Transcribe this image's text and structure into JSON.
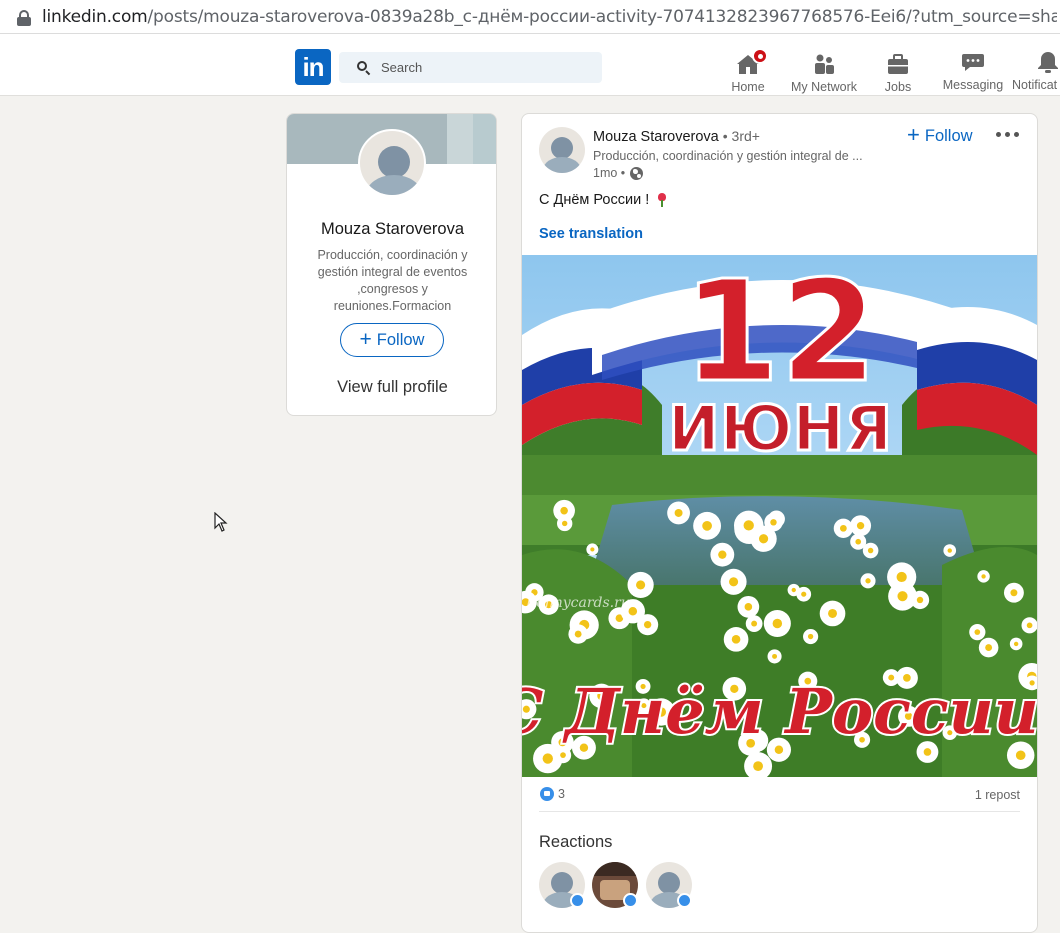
{
  "browser": {
    "url_domain": "linkedin.com",
    "url_path": "/posts/mouza-staroverova-0839a28b_с-днём-россии-activity-7074132823967768576-Eei6/?utm_source=share&utm_m"
  },
  "nav": {
    "logo": "in",
    "search_placeholder": "Search",
    "items": [
      {
        "label": "Home",
        "icon": "home-icon"
      },
      {
        "label": "My Network",
        "icon": "network-icon"
      },
      {
        "label": "Jobs",
        "icon": "briefcase-icon"
      },
      {
        "label": "Messaging",
        "icon": "chat-icon"
      },
      {
        "label": "Notificat",
        "icon": "bell-icon"
      }
    ]
  },
  "profile_card": {
    "name": "Mouza Staroverova",
    "headline": "Producción, coordinación y gestión integral de eventos ,congresos y reuniones.Formacion",
    "follow_label": "Follow",
    "view_profile_label": "View full profile"
  },
  "post": {
    "author": "Mouza Staroverova",
    "degree": "• 3rd+",
    "headline": "Producción, coordinación y gestión integral de ...",
    "time": "1mo •",
    "follow_label": "Follow",
    "text": "С Днём России !",
    "see_translation": "See translation",
    "image": {
      "day": "12",
      "month": "ИЮНЯ",
      "greeting": "С Днём России!",
      "watermark": "Bonnycards.ru"
    },
    "reaction_count": "3",
    "reposts": "1 repost",
    "reactions_title": "Reactions"
  },
  "colors": {
    "linkedin_blue": "#0a66c2",
    "badge_red": "#cc1016",
    "background": "#f3f2ef"
  }
}
